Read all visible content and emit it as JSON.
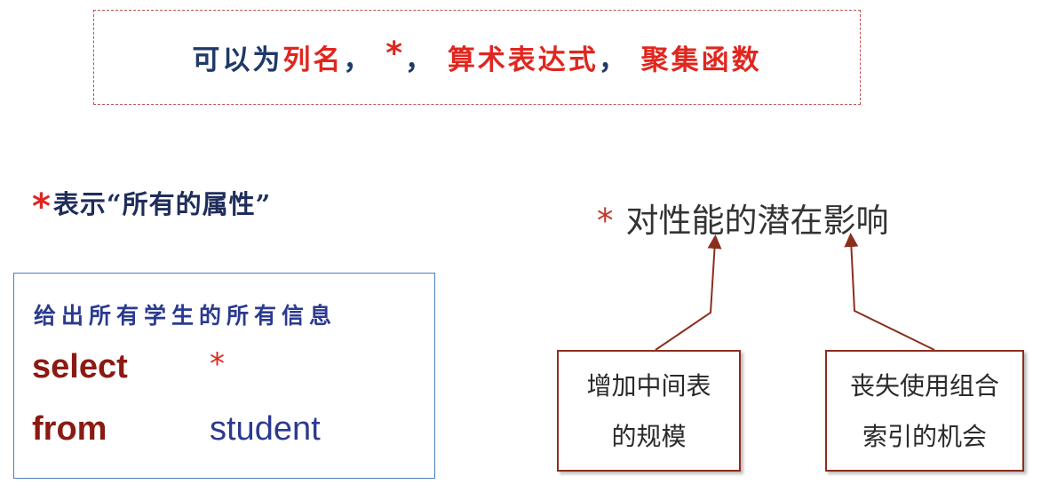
{
  "top_box": {
    "prefix": "可以为",
    "item1": "列名",
    "sep1": "，",
    "star": "*",
    "sep2": "，",
    "item2": "算术表达式",
    "sep3": "，",
    "item3": "聚集函数"
  },
  "left": {
    "star": "*",
    "heading": "表示“所有的属性”"
  },
  "sql_example": {
    "description": "给出所有学生的所有信息",
    "select_keyword": "select",
    "select_value": "*",
    "from_keyword": "from",
    "from_value": "student"
  },
  "right": {
    "star": "*",
    "title": "对性能的潜在影响",
    "notes": [
      {
        "line1": "增加中间表",
        "line2": "的规模"
      },
      {
        "line1": "丧失使用组合",
        "line2": "索引的机会"
      }
    ]
  },
  "colors": {
    "red_accent": "#e0261f",
    "navy_text": "#1f3a68",
    "keyword_dark_red": "#8b1a12",
    "blue_text": "#2b3a90",
    "box_border_blue": "#4a7ebb",
    "connector_brown": "#8b2e1e"
  }
}
